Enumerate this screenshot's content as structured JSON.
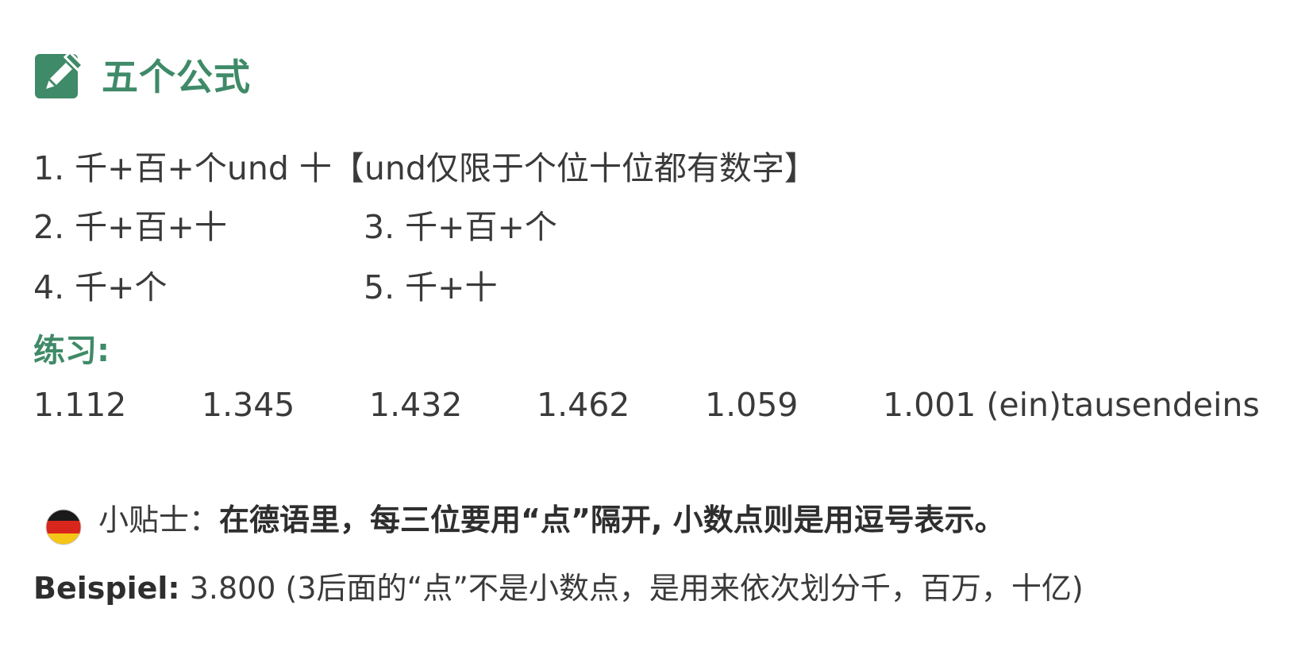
{
  "header": {
    "title": "五个公式",
    "icon": "pencil-edit-icon",
    "accent_color": "#3f8a68"
  },
  "formulas": {
    "f1": "1. 千+百+个und 十【und仅限于个位十位都有数字】",
    "f2": "2. 千+百+十",
    "f3": "3. 千+百+个",
    "f4": "4. 千+个",
    "f5": "5. 千+十"
  },
  "practice": {
    "label": "练习:",
    "items": [
      "1.112",
      "1.345",
      "1.432",
      "1.462",
      "1.059",
      "1.001 (ein)tausendeins"
    ]
  },
  "tip": {
    "icon": "germany-flag-icon",
    "label": "小贴士：",
    "text": "在德语里，每三位要用“点”隔开, 小数点则是用逗号表示。"
  },
  "example": {
    "label": "Beispiel:",
    "text": " 3.800 (3后面的“点”不是小数点，是用来依次划分千，百万，十亿)"
  }
}
